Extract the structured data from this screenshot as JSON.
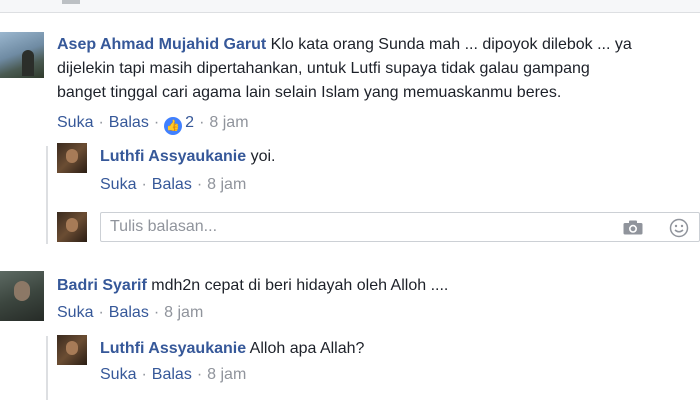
{
  "comments": [
    {
      "author": "Asep Ahmad Mujahid Garut",
      "text_line1": "Klo kata orang Sunda mah ... dipoyok dilebok ... ya",
      "text_line2": "dijelekin tapi masih dipertahankan, untuk Lutfi supaya tidak galau gampang",
      "text_line3": "banget tinggal cari agama lain selain Islam yang memuaskanmu beres.",
      "like_label": "Suka",
      "reply_label": "Balas",
      "reaction_count": "2",
      "time": "8 jam",
      "replies": [
        {
          "author": "Luthfi Assyaukanie",
          "text": "yoi.",
          "like_label": "Suka",
          "reply_label": "Balas",
          "time": "8 jam"
        }
      ],
      "reply_input": {
        "placeholder": "Tulis balasan..."
      }
    },
    {
      "author": "Badri Syarif",
      "text": "mdh2n cepat di beri hidayah oleh Alloh ....",
      "like_label": "Suka",
      "reply_label": "Balas",
      "time": "8 jam",
      "replies": [
        {
          "author": "Luthfi Assyaukanie",
          "text": "Alloh apa Allah?",
          "like_label": "Suka",
          "reply_label": "Balas",
          "time": "8 jam"
        }
      ]
    }
  ],
  "icons": {
    "reaction": "like-icon",
    "camera": "camera-icon",
    "emoji": "smiley-icon"
  },
  "colors": {
    "link": "#365899",
    "meta": "#90949c",
    "reaction": "#4080ff"
  }
}
